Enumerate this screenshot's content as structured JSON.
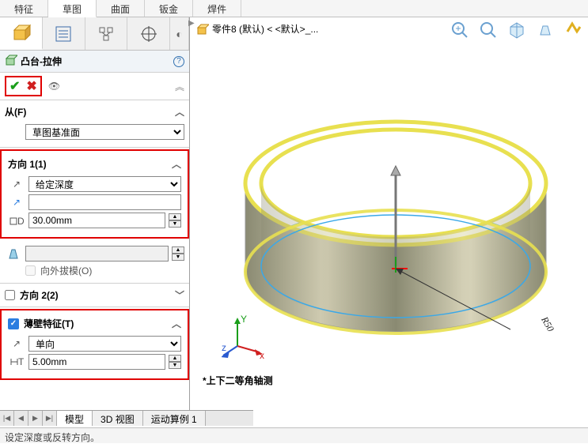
{
  "ribbon": {
    "tabs": [
      "特征",
      "草图",
      "曲面",
      "钣金",
      "焊件"
    ],
    "active": 1
  },
  "panel": {
    "feature_title": "凸台-拉伸"
  },
  "from_section": {
    "label": "从(F)",
    "value": "草图基准面"
  },
  "dir1": {
    "label": "方向 1(1)",
    "end_condition": "给定深度",
    "distance_value": "",
    "depth": "30.00mm",
    "draft_label": "向外拔模(O)"
  },
  "dir2": {
    "label": "方向 2(2)"
  },
  "thin": {
    "label": "薄壁特征(T)",
    "type": "单向",
    "thickness": "5.00mm"
  },
  "viewport": {
    "breadcrumb": "零件8 (默认) < <默认>_...",
    "view_name": "*上下二等角轴测",
    "dim_annotation": "R50",
    "triad": {
      "x": "x",
      "y": "Y",
      "z": "z"
    }
  },
  "bottom_tabs": {
    "items": [
      "模型",
      "3D 视图",
      "运动算例 1"
    ],
    "active": 0
  },
  "status": "设定深度或反转方向。"
}
